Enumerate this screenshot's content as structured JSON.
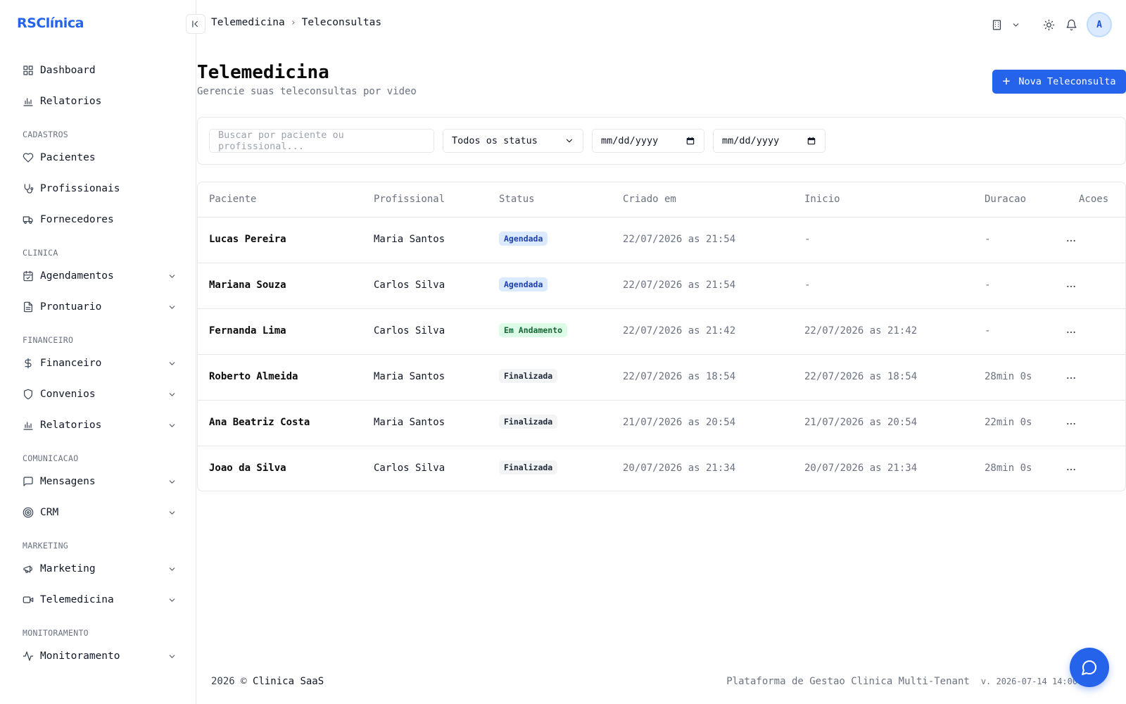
{
  "app": {
    "logo": "RSClínica"
  },
  "breadcrumb": {
    "parent": "Telemedicina",
    "current": "Teleconsultas"
  },
  "header": {
    "avatar_initial": "A"
  },
  "sidebar": {
    "items": [
      {
        "label": "Dashboard",
        "icon": "dashboard-icon"
      },
      {
        "label": "Relatorios",
        "icon": "bar-chart-icon"
      }
    ],
    "sections": [
      {
        "title": "CADASTROS",
        "items": [
          {
            "label": "Pacientes",
            "icon": "heart-icon"
          },
          {
            "label": "Profissionais",
            "icon": "stethoscope-icon"
          },
          {
            "label": "Fornecedores",
            "icon": "truck-icon"
          }
        ]
      },
      {
        "title": "CLINICA",
        "items": [
          {
            "label": "Agendamentos",
            "icon": "calendar-check-icon"
          },
          {
            "label": "Prontuario",
            "icon": "file-text-icon"
          }
        ]
      },
      {
        "title": "FINANCEIRO",
        "items": [
          {
            "label": "Financeiro",
            "icon": "dollar-icon"
          },
          {
            "label": "Convenios",
            "icon": "shield-icon"
          },
          {
            "label": "Relatorios",
            "icon": "bar-chart-icon"
          }
        ]
      },
      {
        "title": "COMUNICACAO",
        "items": [
          {
            "label": "Mensagens",
            "icon": "message-square-icon"
          },
          {
            "label": "CRM",
            "icon": "target-icon"
          }
        ]
      },
      {
        "title": "MARKETING",
        "items": [
          {
            "label": "Marketing",
            "icon": "megaphone-icon"
          },
          {
            "label": "Telemedicina",
            "icon": "video-icon"
          }
        ]
      },
      {
        "title": "MONITORAMENTO",
        "items": [
          {
            "label": "Monitoramento",
            "icon": "activity-icon"
          }
        ]
      }
    ]
  },
  "page": {
    "title": "Telemedicina",
    "subtitle": "Gerencie suas teleconsultas por video",
    "new_button": "Nova Teleconsulta"
  },
  "filters": {
    "search_placeholder": "Buscar por paciente ou profissional...",
    "status_value": "Todos os status",
    "date_from": "mm/dd/yyyy",
    "date_to": "mm/dd/yyyy"
  },
  "table": {
    "headers": [
      "Paciente",
      "Profissional",
      "Status",
      "Criado em",
      "Inicio",
      "Duracao",
      "Acoes"
    ],
    "rows": [
      {
        "paciente": "Lucas Pereira",
        "profissional": "Maria Santos",
        "status": "Agendada",
        "status_color": "blue",
        "criado": "22/07/2026 as 21:54",
        "inicio": "-",
        "duracao": "-"
      },
      {
        "paciente": "Mariana Souza",
        "profissional": "Carlos Silva",
        "status": "Agendada",
        "status_color": "blue",
        "criado": "22/07/2026 as 21:54",
        "inicio": "-",
        "duracao": "-"
      },
      {
        "paciente": "Fernanda Lima",
        "profissional": "Carlos Silva",
        "status": "Em Andamento",
        "status_color": "green",
        "criado": "22/07/2026 as 21:42",
        "inicio": "22/07/2026 as 21:42",
        "duracao": "-"
      },
      {
        "paciente": "Roberto Almeida",
        "profissional": "Maria Santos",
        "status": "Finalizada",
        "status_color": "gray",
        "criado": "22/07/2026 as 18:54",
        "inicio": "22/07/2026 as 18:54",
        "duracao": "28min 0s"
      },
      {
        "paciente": "Ana Beatriz Costa",
        "profissional": "Maria Santos",
        "status": "Finalizada",
        "status_color": "gray",
        "criado": "21/07/2026 as 20:54",
        "inicio": "21/07/2026 as 20:54",
        "duracao": "22min 0s"
      },
      {
        "paciente": "Joao da Silva",
        "profissional": "Carlos Silva",
        "status": "Finalizada",
        "status_color": "gray",
        "criado": "20/07/2026 as 21:34",
        "inicio": "20/07/2026 as 21:34",
        "duracao": "28min 0s"
      }
    ]
  },
  "footer": {
    "year": "2026 ©",
    "brand": "Clinica SaaS",
    "platform": "Plataforma de Gestao Clinica Multi-Tenant",
    "version": "v. 2026-07-14 14:00 UTC"
  },
  "colors": {
    "primary": "#2563eb",
    "border": "#e5e7eb",
    "muted": "#6b7280"
  }
}
